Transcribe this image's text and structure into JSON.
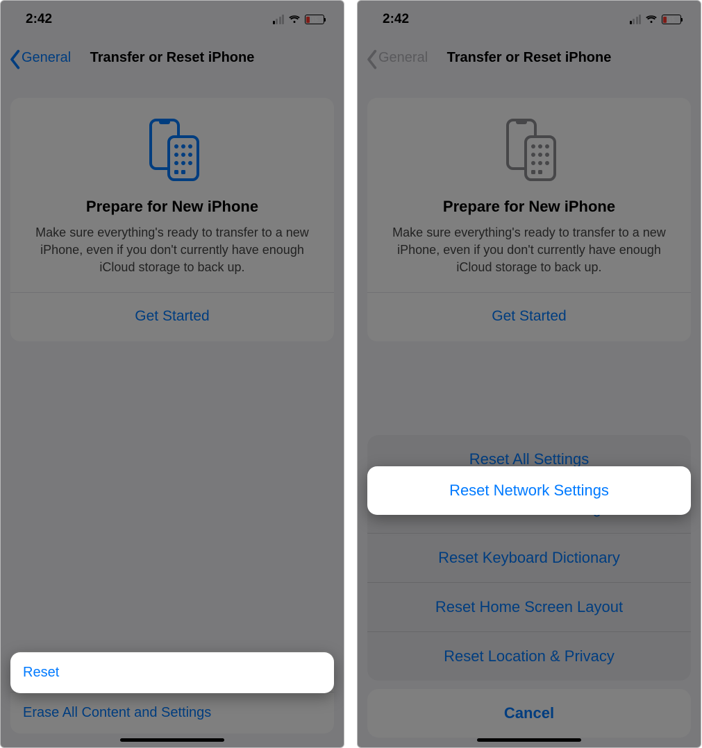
{
  "status": {
    "time": "2:42",
    "battery_percent": "15"
  },
  "nav": {
    "back_label": "General",
    "title": "Transfer or Reset iPhone"
  },
  "prepare": {
    "title": "Prepare for New iPhone",
    "desc": "Make sure everything's ready to transfer to a new iPhone, even if you don't currently have enough iCloud storage to back up.",
    "get_started": "Get Started"
  },
  "bottom": {
    "reset": "Reset",
    "erase": "Erase All Content and Settings"
  },
  "sheet": {
    "opt1": "Reset All Settings",
    "opt2": "Reset Network Settings",
    "opt3": "Reset Keyboard Dictionary",
    "opt4": "Reset Home Screen Layout",
    "opt5": "Reset Location & Privacy",
    "cancel": "Cancel"
  }
}
